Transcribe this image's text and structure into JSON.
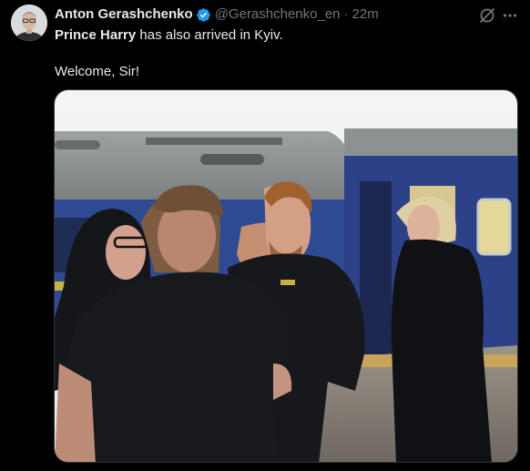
{
  "author": {
    "display_name": "Anton Gerashchenko",
    "handle": "@Gerashchenko_en",
    "separator": "·",
    "timestamp": "22m",
    "verified": true
  },
  "tweet": {
    "mention": "Prince Harry",
    "line1_rest": " has also arrived in Kyiv.",
    "line2": "Welcome, Sir!"
  },
  "icons": {
    "verified": "verified-badge-icon",
    "grok": "grok-icon",
    "more": "more-icon"
  },
  "colors": {
    "background": "#000000",
    "text": "#e7e9ea",
    "secondary": "#71767b",
    "verified": "#1d9bf0"
  }
}
